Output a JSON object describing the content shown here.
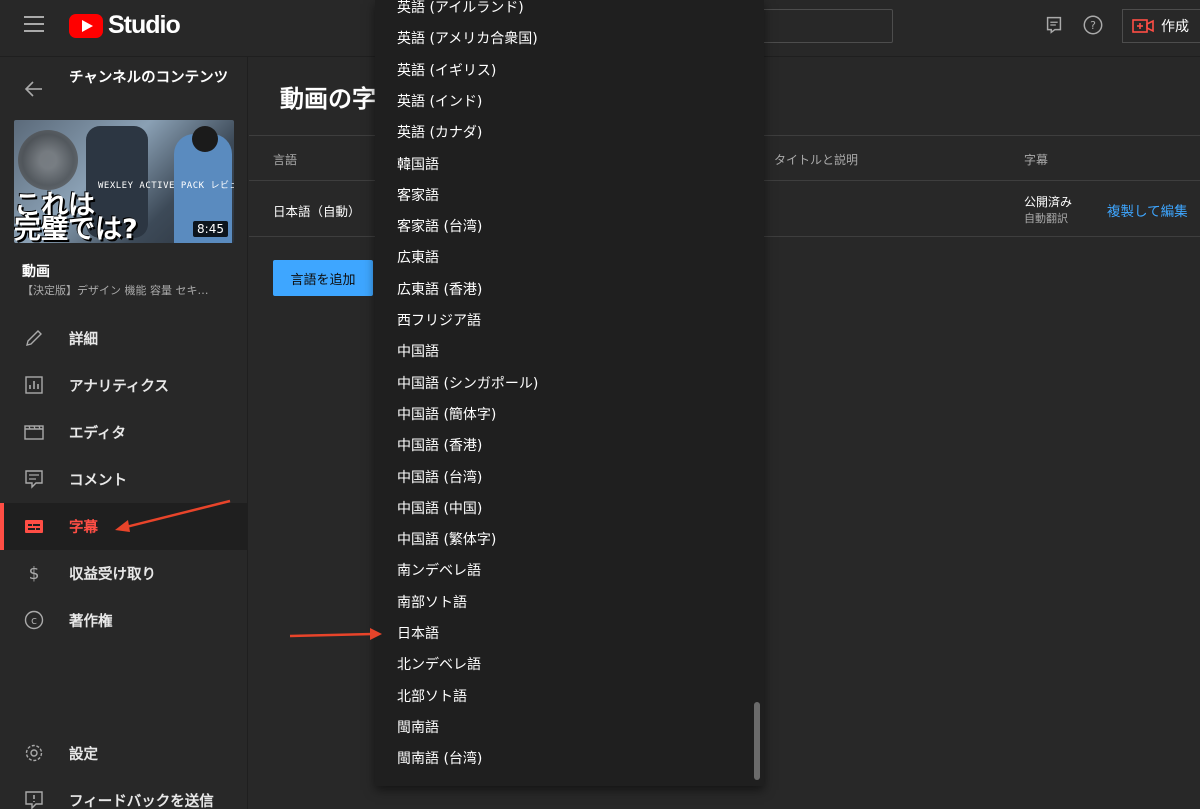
{
  "header": {
    "logo_text": "Studio",
    "create_label": "作成"
  },
  "sidebar": {
    "channel_title": "チャンネルのコンテンツ",
    "thumbnail": {
      "caption": "WEXLEY ACTIVE PACK レビュー",
      "big_text": "これは\n完璧では?",
      "duration": "8:45"
    },
    "video_label": "動画",
    "video_title": "【決定版】デザイン 機能 容量 セキ…",
    "nav": [
      {
        "label": "詳細",
        "icon": "pencil-icon"
      },
      {
        "label": "アナリティクス",
        "icon": "analytics-icon"
      },
      {
        "label": "エディタ",
        "icon": "editor-icon"
      },
      {
        "label": "コメント",
        "icon": "comment-icon"
      },
      {
        "label": "字幕",
        "icon": "subtitles-icon"
      },
      {
        "label": "収益受け取り",
        "icon": "dollar-icon"
      },
      {
        "label": "著作権",
        "icon": "copyright-icon"
      }
    ],
    "settings_label": "設定",
    "feedback_label": "フィードバックを送信"
  },
  "main": {
    "page_title": "動画の字幕",
    "columns": {
      "language": "言語",
      "title_desc": "タイトルと説明",
      "subtitles": "字幕"
    },
    "row": {
      "language": "日本語（自動）",
      "status": "公開済み",
      "status_sub": "自動翻訳",
      "action": "複製して編集"
    },
    "add_language_button": "言語を追加"
  },
  "dropdown": {
    "items": [
      "英語 (アイルランド)",
      "英語 (アメリカ合衆国)",
      "英語 (イギリス)",
      "英語 (インド)",
      "英語 (カナダ)",
      "韓国語",
      "客家語",
      "客家語 (台湾)",
      "広東語",
      "広東語 (香港)",
      "西フリジア語",
      "中国語",
      "中国語 (シンガポール)",
      "中国語 (簡体字)",
      "中国語 (香港)",
      "中国語 (台湾)",
      "中国語 (中国)",
      "中国語 (繁体字)",
      "南ンデベレ語",
      "南部ソト語",
      "日本語",
      "北ンデベレ語",
      "北部ソト語",
      "閩南語",
      "閩南語 (台湾)"
    ]
  },
  "colors": {
    "accent_red": "#ff4e45",
    "link_blue": "#3ea6ff",
    "annotation_arrow": "#e8442a"
  }
}
